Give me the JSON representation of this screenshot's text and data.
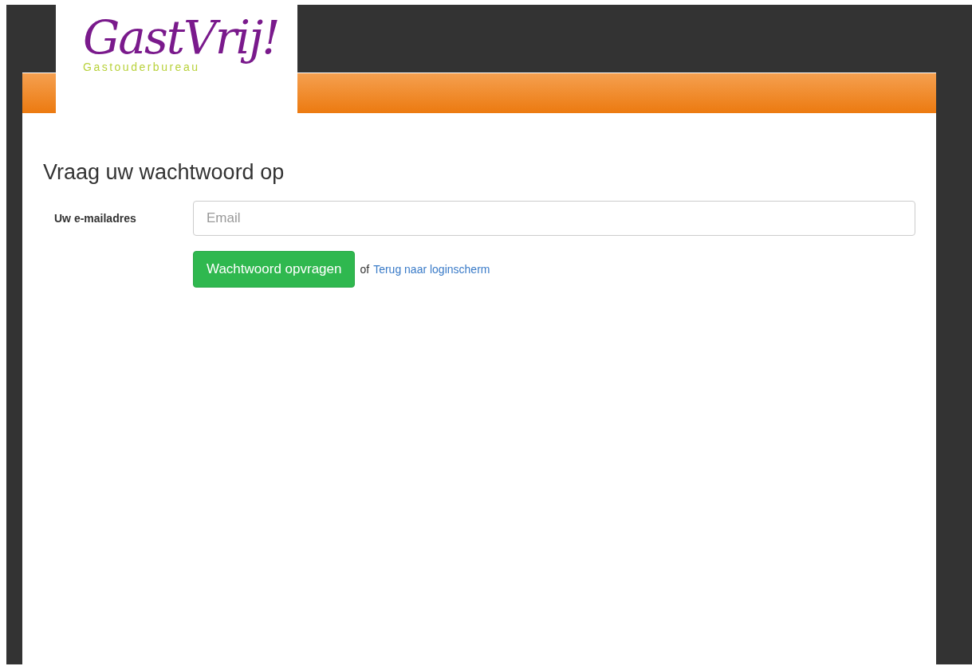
{
  "logo": {
    "name": "GastVrij!",
    "tagline": "Gastouderbureau"
  },
  "heading": "Vraag uw wachtwoord op",
  "form": {
    "label": "Uw e-mailadres",
    "placeholder": "Email",
    "submit": "Wachtwoord opvragen",
    "separator": "of",
    "back_link": "Terug naar loginscherm"
  }
}
